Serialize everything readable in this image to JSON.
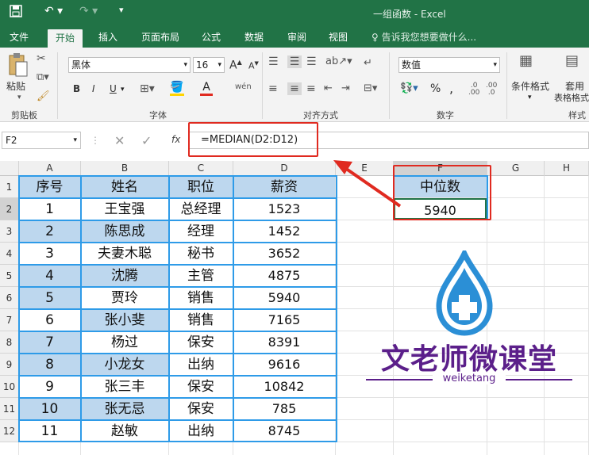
{
  "window": {
    "title": "一组函数 - Excel"
  },
  "tabs": [
    "文件",
    "开始",
    "插入",
    "页面布局",
    "公式",
    "数据",
    "审阅",
    "视图"
  ],
  "tell_me": "告诉我您想要做什么...",
  "ribbon": {
    "paste_label": "粘贴",
    "clipboard_label": "剪贴板",
    "font_name": "黑体",
    "font_size": "16",
    "font_group": "字体",
    "bold": "B",
    "italic": "I",
    "underline": "U",
    "font_grow": "A",
    "font_shrink": "A",
    "align_group": "对齐方式",
    "number_format": "数值",
    "number_group": "数字",
    "percent": "%",
    "comma": ",",
    "cond_format": "条件格式",
    "table_format_1": "套用",
    "table_format_2": "表格格式",
    "styles_group": "样式"
  },
  "name_box": "F2",
  "formula": "=MEDIAN(D2:D12)",
  "columns": [
    "A",
    "B",
    "C",
    "D",
    "E",
    "F",
    "G",
    "H"
  ],
  "rows": [
    "1",
    "2",
    "3",
    "4",
    "5",
    "6",
    "7",
    "8",
    "9",
    "10",
    "11",
    "12"
  ],
  "table": {
    "headers": [
      "序号",
      "姓名",
      "职位",
      "薪资"
    ],
    "records": [
      [
        "1",
        "王宝强",
        "总经理",
        "1523"
      ],
      [
        "2",
        "陈思成",
        "经理",
        "1452"
      ],
      [
        "3",
        "夫妻木聪",
        "秘书",
        "3652"
      ],
      [
        "4",
        "沈腾",
        "主管",
        "4875"
      ],
      [
        "5",
        "贾玲",
        "销售",
        "5940"
      ],
      [
        "6",
        "张小斐",
        "销售",
        "7165"
      ],
      [
        "7",
        "杨过",
        "保安",
        "8391"
      ],
      [
        "8",
        "小龙女",
        "出纳",
        "9616"
      ],
      [
        "9",
        "张三丰",
        "保安",
        "10842"
      ],
      [
        "10",
        "张无忌",
        "保安",
        "785"
      ],
      [
        "11",
        "赵敏",
        "出纳",
        "8745"
      ]
    ]
  },
  "median": {
    "label": "中位数",
    "value": "5940"
  },
  "logo": {
    "name": "文老师微课堂",
    "sub": "weiketang"
  },
  "colors": {
    "excel_green": "#217346",
    "highlight": "#bdd7ee",
    "red": "#e02a20",
    "logo_purple": "#5b1f8a",
    "drop_blue": "#2b8fd6"
  }
}
